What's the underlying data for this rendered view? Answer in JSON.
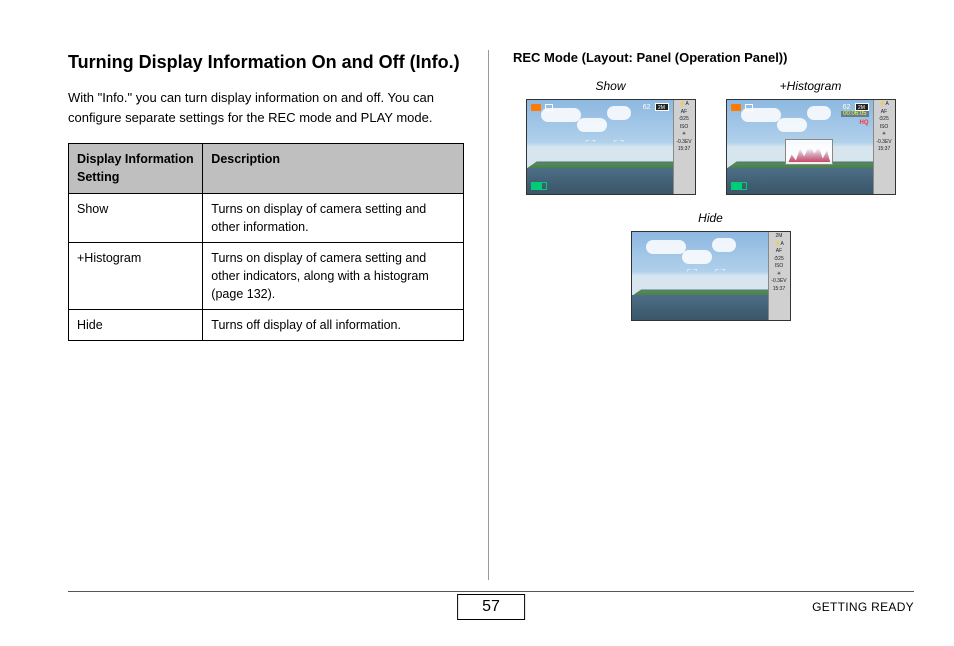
{
  "left": {
    "heading": "Turning Display Information On and Off (Info.)",
    "intro": "With \"Info.\" you can turn display information on and off. You can configure separate settings for the REC mode and PLAY mode.",
    "table": {
      "header1": "Display Information Setting",
      "header2": "Description",
      "rows": [
        {
          "setting": "Show",
          "desc": "Turns on display of camera setting and other information."
        },
        {
          "setting": "+Histogram",
          "desc": "Turns on display of camera setting and other indicators, along with a histogram (page 132)."
        },
        {
          "setting": "Hide",
          "desc": "Turns off display of all information."
        }
      ]
    }
  },
  "right": {
    "title": "REC Mode (Layout: Panel (Operation Panel))",
    "labels": {
      "show": "Show",
      "histogram": "+Histogram",
      "hide": "Hide"
    },
    "overlay": {
      "count": "62",
      "size": "2M",
      "rectime": "00:06:05",
      "hq": "HQ",
      "panel": [
        "⚡A",
        "AF",
        "⏱25",
        "ISO",
        "✳",
        "-0.3EV",
        "15:37"
      ]
    }
  },
  "footer": {
    "page": "57",
    "section": "GETTING READY"
  }
}
